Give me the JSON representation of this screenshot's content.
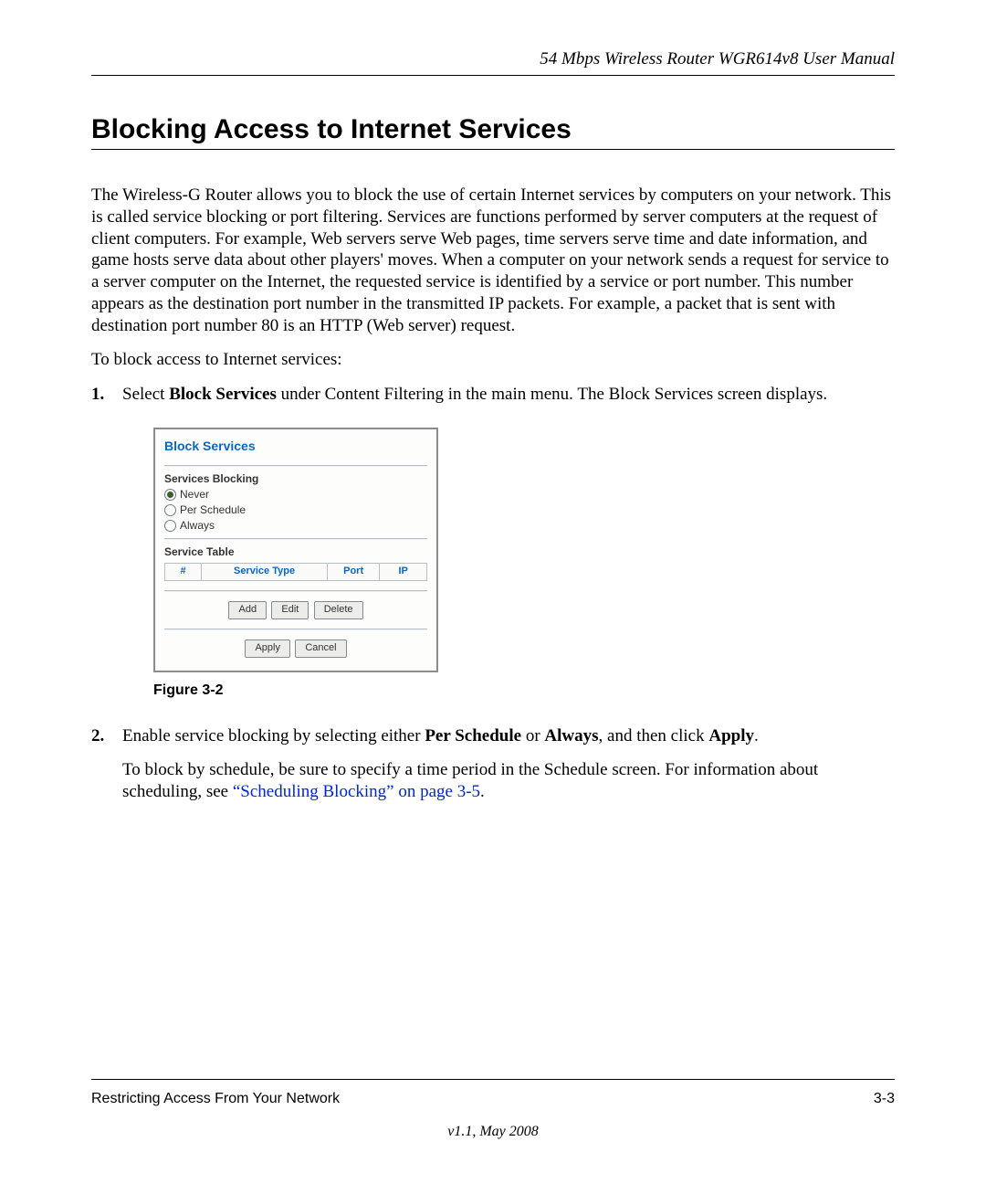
{
  "header": {
    "running": "54 Mbps Wireless Router WGR614v8 User Manual"
  },
  "section": {
    "title": "Blocking Access to Internet Services",
    "intro": "The Wireless-G Router allows you to block the use of certain Internet services by computers on your network. This is called service blocking or port filtering. Services are functions performed by server computers at the request of client computers. For example, Web servers serve Web pages, time servers serve time and date information, and game hosts serve data about other players' moves. When a computer on your network sends a request for service to a server computer on the Internet, the requested service is identified by a service or port number. This number appears as the destination port number in the transmitted IP packets. For example, a packet that is sent with destination port number 80 is an HTTP (Web server) request.",
    "lead": "To block access to Internet services:"
  },
  "steps": {
    "s1_pre": "Select ",
    "s1_bold": "Block Services",
    "s1_post": " under Content Filtering in the main menu. The Block Services screen displays.",
    "s2_a": "Enable service blocking by selecting either ",
    "s2_b": "Per Schedule",
    "s2_c": " or ",
    "s2_d": "Always",
    "s2_e": ", and then click ",
    "s2_f": "Apply",
    "s2_g": ".",
    "s2_p2_a": "To block by schedule, be sure to specify a time period in the Schedule screen. For information about scheduling, see ",
    "s2_link": "“Scheduling Blocking” on page 3-5",
    "s2_p2_b": "."
  },
  "figure": {
    "caption": "Figure 3-2",
    "panel_title": "Block Services",
    "blocking_label": "Services Blocking",
    "radios": {
      "never": "Never",
      "per_schedule": "Per Schedule",
      "always": "Always"
    },
    "selected_radio": "never",
    "table_label": "Service Table",
    "columns": {
      "num": "#",
      "type": "Service Type",
      "port": "Port",
      "ip": "IP"
    },
    "buttons": {
      "add": "Add",
      "edit": "Edit",
      "delete": "Delete",
      "apply": "Apply",
      "cancel": "Cancel"
    }
  },
  "footer": {
    "section": "Restricting Access From Your Network",
    "pagenum": "3-3",
    "version": "v1.1, May 2008"
  }
}
